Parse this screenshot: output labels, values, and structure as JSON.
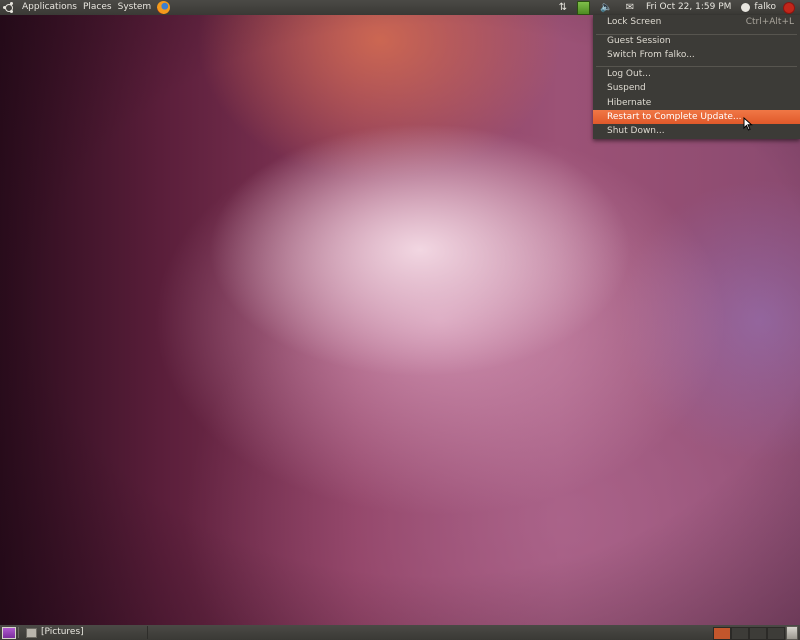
{
  "top_panel": {
    "menus": [
      "Applications",
      "Places",
      "System"
    ],
    "clock": "Fri Oct 22,  1:59 PM",
    "user": "falko"
  },
  "session_menu": {
    "items": [
      {
        "label": "Lock Screen",
        "accel": "Ctrl+Alt+L"
      },
      {
        "label": "Guest Session"
      },
      {
        "label": "Switch From falko..."
      },
      {
        "label": "Log Out..."
      },
      {
        "label": "Suspend"
      },
      {
        "label": "Hibernate"
      },
      {
        "label": "Restart to Complete Update..."
      },
      {
        "label": "Shut Down..."
      }
    ],
    "active_item": "Restart to Complete Update..."
  },
  "bottom_panel": {
    "task_label": "[Pictures]",
    "workspaces": 4,
    "active_workspace": 1
  },
  "colors": {
    "panel": "#3c3b37",
    "menu_bg": "#3c3b37",
    "highlight": "#f07746",
    "panel_text": "#e8e6df"
  }
}
